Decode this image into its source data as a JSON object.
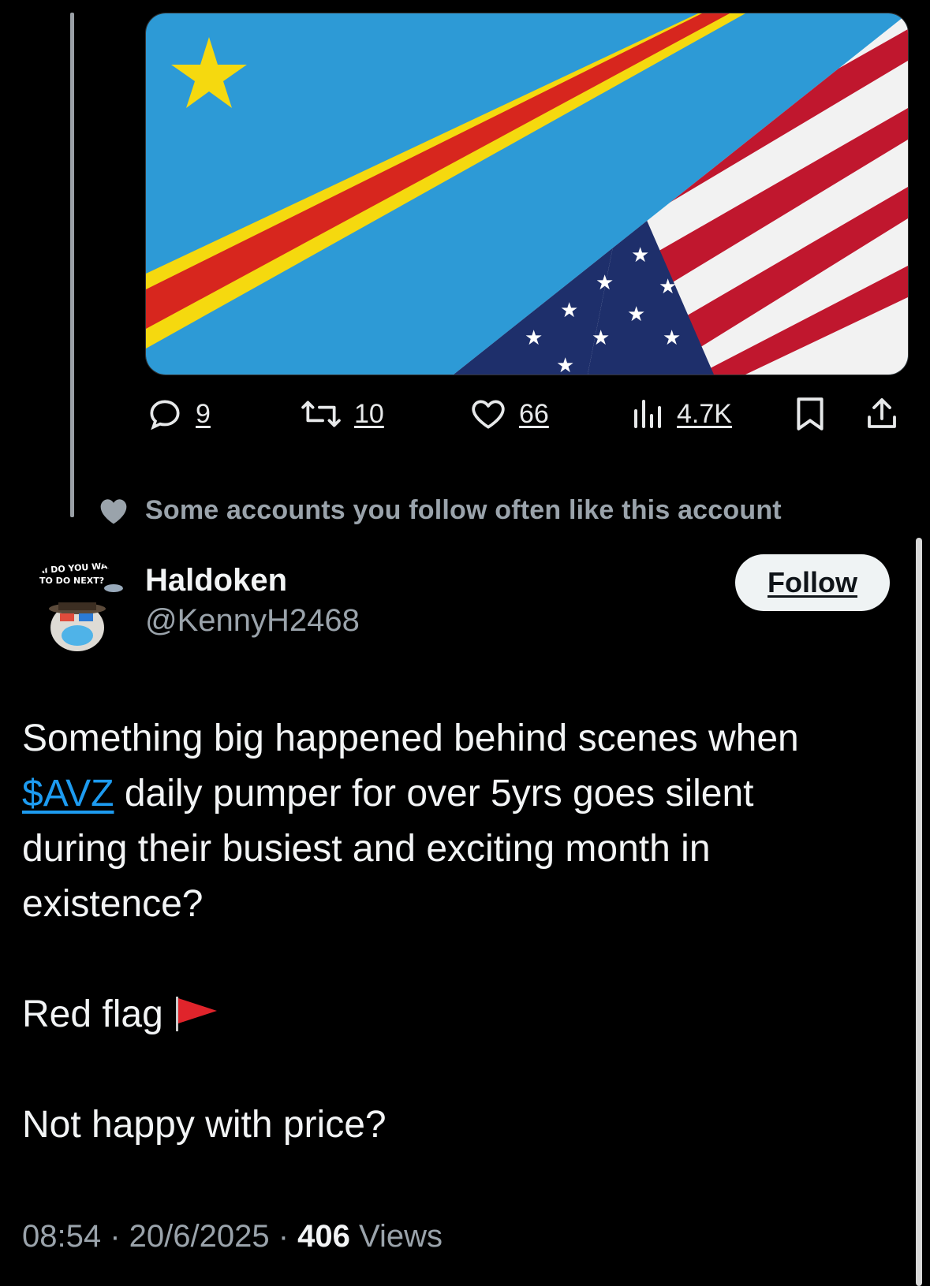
{
  "tweet_actions": {
    "replies": "9",
    "reposts": "10",
    "likes": "66",
    "views": "4.7K"
  },
  "social_context": {
    "text": "Some accounts you follow often like this account"
  },
  "author": {
    "display_name": "Haldoken",
    "handle": "@KennyH2468",
    "avatar_text": "AI DO YOU WANT TO DO NEXT?"
  },
  "follow_label": "Follow",
  "post": {
    "line1": "Something big happened behind scenes when",
    "cashtag": "$AVZ",
    "line2_rest": " daily pumper for over 5yrs goes silent",
    "line3": "during their busiest and exciting month in",
    "line4": "existence?",
    "red_flag": "Red flag",
    "question": "Not happy with price?"
  },
  "meta": {
    "time": "08:54",
    "sep": " · ",
    "date": "20/6/2025",
    "views_count": "406",
    "views_label": " Views"
  },
  "colors": {
    "background": "#000000",
    "accent": "#1d9bf0",
    "muted": "#9aa3ab",
    "flag_blue": "#2d9ad6",
    "flag_red": "#d7261e",
    "flag_yellow": "#f5d90f",
    "us_navy": "#1e2f6b"
  }
}
